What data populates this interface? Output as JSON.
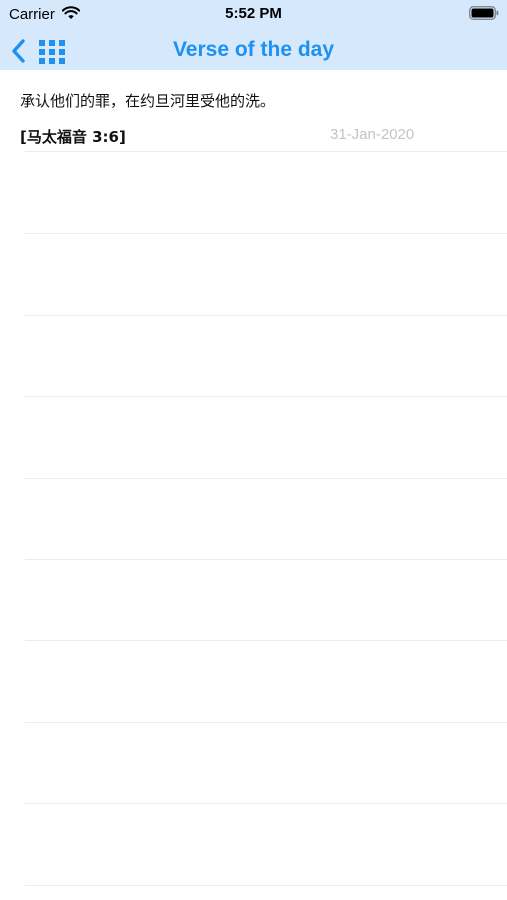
{
  "status_bar": {
    "carrier": "Carrier",
    "time": "5:52 PM",
    "icons": [
      "wifi-icon",
      "battery-icon"
    ]
  },
  "nav_bar": {
    "title": "Verse of the day",
    "back_icon": "chevron-left-icon",
    "menu_icon": "grid-icon",
    "accent_color": "#1e90f0",
    "background_color": "#d6e8fb"
  },
  "verse": {
    "text": "承认他们的罪，在约旦河里受他的洗。",
    "reference": "[马太福音 3:6]",
    "date": "31-Jan-2020"
  }
}
